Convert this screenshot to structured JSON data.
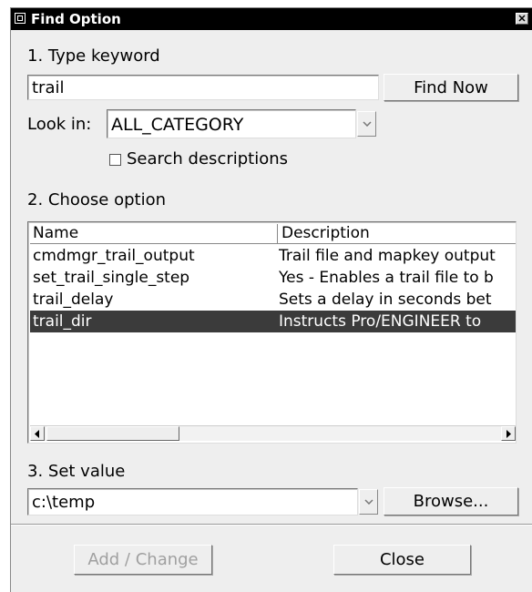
{
  "window": {
    "title": "Find Option",
    "close_label": "✕"
  },
  "step1": {
    "label": "1. Type keyword",
    "keyword_value": "trail",
    "find_button": "Find Now",
    "look_in_label": "Look in:",
    "look_in_value": "ALL_CATEGORY",
    "search_descriptions_label": "Search descriptions",
    "search_descriptions_checked": false
  },
  "step2": {
    "label": "2. Choose option",
    "columns": [
      "Name",
      "Description"
    ],
    "rows": [
      {
        "name": "cmdmgr_trail_output",
        "description": "Trail file and mapkey output",
        "selected": false
      },
      {
        "name": "set_trail_single_step",
        "description": "Yes - Enables a trail file to b",
        "selected": false
      },
      {
        "name": "trail_delay",
        "description": "Sets a delay in seconds bet",
        "selected": false
      },
      {
        "name": "trail_dir",
        "description": "Instructs Pro/ENGINEER to",
        "selected": true
      }
    ]
  },
  "step3": {
    "label": "3. Set value",
    "value": "c:\\temp",
    "browse_button": "Browse..."
  },
  "footer": {
    "add_change_button": "Add / Change",
    "close_button": "Close"
  },
  "colors": {
    "titlebar": "#000000",
    "dialog_bg": "#eeeeee",
    "selection": "#3b3b3b"
  },
  "icons": [
    "window-menu-icon",
    "close-icon",
    "chevron-down-icon",
    "scroll-left-icon",
    "scroll-right-icon"
  ]
}
